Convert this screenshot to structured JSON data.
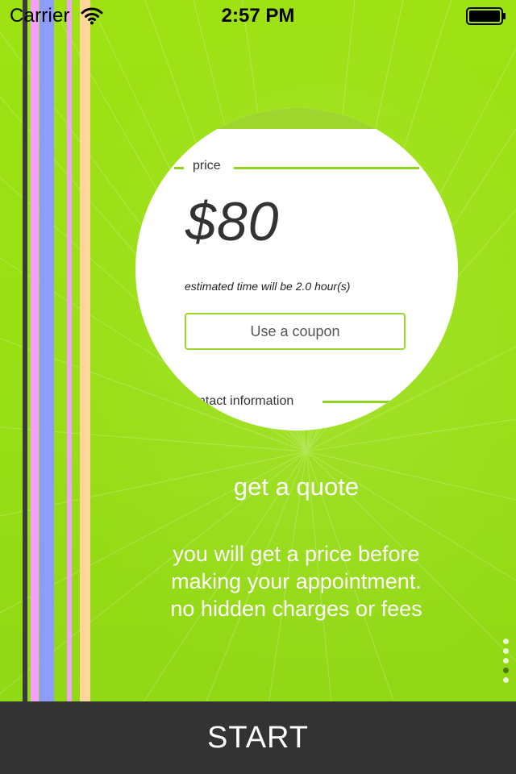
{
  "status_bar": {
    "carrier": "Carrier",
    "time": "2:57 PM",
    "icons": [
      "wifi-icon",
      "battery-icon"
    ]
  },
  "preview": {
    "price_section_label": "price",
    "price": "$80",
    "estimate": "estimated time will be 2.0 hour(s)",
    "coupon_button": "Use a coupon",
    "contact_section_label": "ntact information"
  },
  "feature": {
    "title": "get a quote",
    "description_lines": [
      "you will get a price before",
      "making your appointment.",
      "no hidden charges or fees"
    ]
  },
  "pager": {
    "total": 5,
    "current_index": 3
  },
  "footer": {
    "start_label": "START"
  },
  "colors": {
    "background_green": "#99e012",
    "accent_green": "#8fd41f",
    "footer_dark": "#333333",
    "stripes": [
      "#3a3a3a",
      "#f4a0ff",
      "#8f9cff",
      "#f4a0ff",
      "#ffd59a"
    ]
  }
}
